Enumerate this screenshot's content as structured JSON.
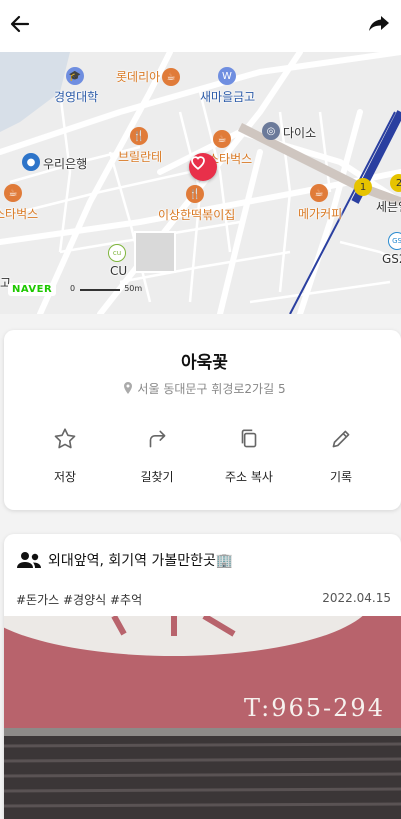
{
  "topbar": {
    "back_icon": "arrow-left-icon",
    "share_icon": "share-arrow-icon"
  },
  "map": {
    "pois": {
      "lotteria": "롯데리아",
      "kyunghee": "경영대학",
      "saemaeul": "새마을금고",
      "daiso": "다이소",
      "woori": "우리은행",
      "brilante": "브릴란테",
      "starbucks": "스타벅스",
      "starbucks2": "스타벅스",
      "isanghan": "이상한떡볶이집",
      "mega": "메가커피",
      "seven": "세븐일",
      "gs25": "GS2",
      "cu": "CU",
      "go": "고"
    },
    "subway": {
      "line1": "1",
      "line2": "2"
    },
    "naver_logo": "NAVER",
    "scale": {
      "zero": "0",
      "distance": "50m"
    },
    "pin_color": "#e8304a"
  },
  "place": {
    "name": "아욱꽃",
    "address": "서울 동대문구 휘경로2가길 5"
  },
  "actions": [
    {
      "label": "저장",
      "icon": "star-icon"
    },
    {
      "label": "길찾기",
      "icon": "route-arrow-icon"
    },
    {
      "label": "주소 복사",
      "icon": "copy-icon"
    },
    {
      "label": "기록",
      "icon": "pencil-icon"
    }
  ],
  "review": {
    "title": "외대앞역, 회기역 가볼만한곳🏢",
    "tags": "#돈가스 #경양식 #추억",
    "date": "2022.04.15",
    "sign_text": "T:965-294"
  },
  "colors": {
    "accent": "#e8304a",
    "primary_text": "#222222",
    "secondary_text": "#888888"
  }
}
